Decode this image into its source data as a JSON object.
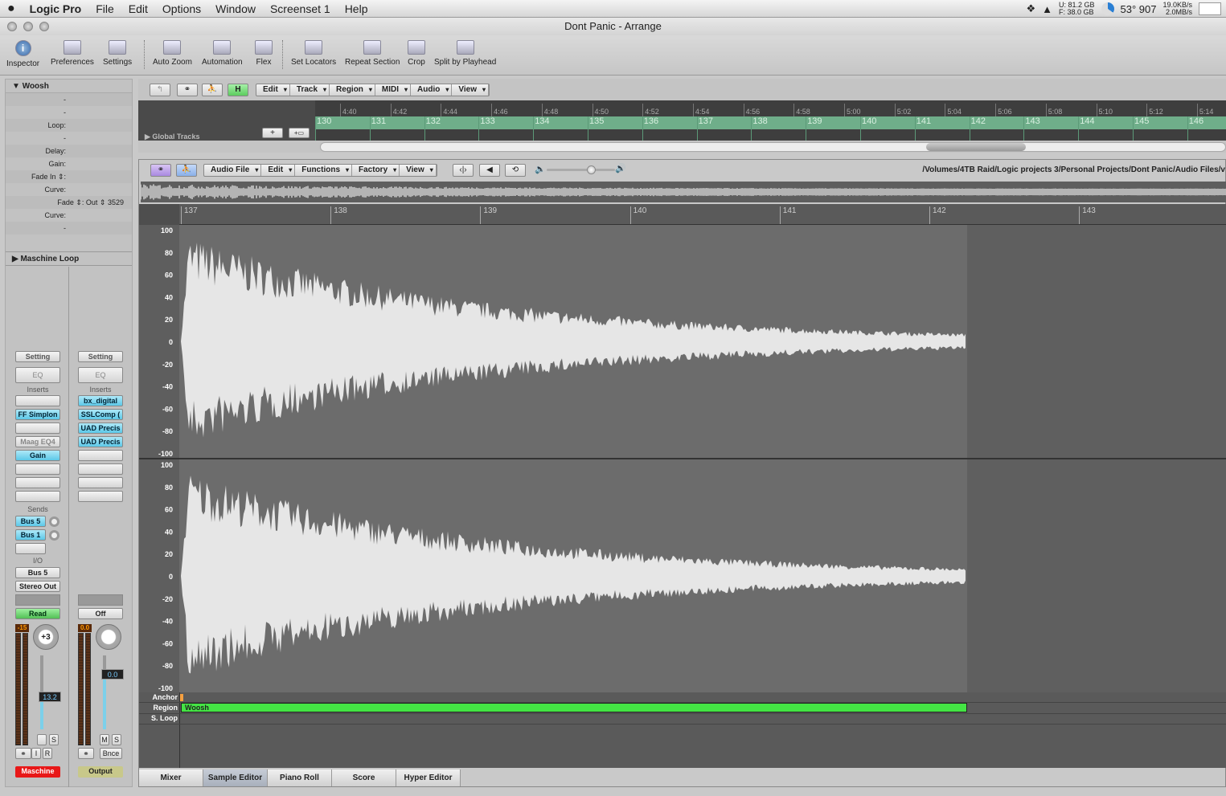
{
  "menubar": {
    "app": "Logic Pro",
    "items": [
      "File",
      "Edit",
      "Options",
      "Window",
      "Screenset 1",
      "Help"
    ],
    "status": {
      "hdd_used": "U: 81.2 GB",
      "hdd_free": "F: 38.0 GB",
      "temp": "53° 907",
      "net_in": "19.0KB/s",
      "net_out": "2.0MB/s"
    }
  },
  "window": {
    "title": "Dont Panic - Arrange"
  },
  "toolbar": [
    "Inspector",
    "Preferences",
    "Settings",
    "Auto Zoom",
    "Automation",
    "Flex",
    "Set Locators",
    "Repeat Section",
    "Crop",
    "Split by Playhead"
  ],
  "inspector": {
    "region_name": "Woosh",
    "rows": [
      "-",
      "-",
      "Loop:",
      "-",
      "Delay:",
      "Gain:",
      "Fade In ⇕:",
      "Curve:",
      "Fade ⇕: Out   ⇕  3529",
      "Curve:",
      "-"
    ],
    "track_name": "Maschine Loop",
    "strip1": {
      "setting": "Setting",
      "eq": "EQ",
      "inserts_label": "Inserts",
      "inserts": [
        "",
        "FF Simplon",
        "",
        "Maag EQ4",
        "Gain",
        "",
        "",
        ""
      ],
      "sends_label": "Sends",
      "sends": [
        "Bus 5",
        "Bus 1",
        ""
      ],
      "io_label": "I/O",
      "input": "Bus 5",
      "output": "Stereo Out",
      "automation": "Read",
      "peak": "-15",
      "pan": "+3",
      "fader": "13.2",
      "fader_level": 0.45,
      "btns": [
        "",
        "S",
        "I",
        "R"
      ],
      "name": "Maschine",
      "name_color": "#e81818"
    },
    "strip2": {
      "setting": "Setting",
      "eq": "EQ",
      "inserts_label": "Inserts",
      "inserts": [
        "bx_digital",
        "SSLComp (",
        "UAD Precis",
        "UAD Precis",
        "",
        "",
        "",
        ""
      ],
      "automation": "Off",
      "peak": "0.0",
      "fader": "0.0",
      "fader_level": 0.75,
      "btns": [
        "M",
        "S",
        "Bnce"
      ],
      "name": "Output",
      "name_color": "#c8c88a"
    }
  },
  "arrange": {
    "menus": [
      "Edit",
      "Track",
      "Region",
      "MIDI",
      "Audio",
      "View"
    ],
    "h_button": "H",
    "global_tracks": "Global Tracks",
    "time_ticks": [
      "4:40",
      "4:42",
      "4:44",
      "4:46",
      "4:48",
      "4:50",
      "4:52",
      "4:54",
      "4:56",
      "4:58",
      "5:00",
      "5:02",
      "5:04",
      "5:06",
      "5:08",
      "5:10",
      "5:12",
      "5:14"
    ],
    "bars": [
      "130",
      "131",
      "132",
      "133",
      "134",
      "135",
      "136",
      "137",
      "138",
      "139",
      "140",
      "141",
      "142",
      "143",
      "144",
      "145",
      "146"
    ]
  },
  "editor": {
    "menus": [
      "Audio File",
      "Edit",
      "Functions",
      "Factory",
      "View"
    ],
    "path": "/Volumes/4TB Raid/Logic projects 3/Personal Projects/Dont Panic/Audio Files/v",
    "ruler": [
      "137",
      "138",
      "139",
      "140",
      "141",
      "142",
      "143"
    ],
    "amplitude_labels": [
      "100",
      "80",
      "60",
      "40",
      "20",
      "0",
      "-20",
      "-40",
      "-60",
      "-80",
      "-100"
    ],
    "rows": [
      "Anchor",
      "Region",
      "S. Loop"
    ],
    "region_name": "Woosh",
    "region_color": "#44e444"
  },
  "tabs": [
    "Mixer",
    "Sample Editor",
    "Piano Roll",
    "Score",
    "Hyper Editor"
  ],
  "selected_tab": "Sample Editor"
}
